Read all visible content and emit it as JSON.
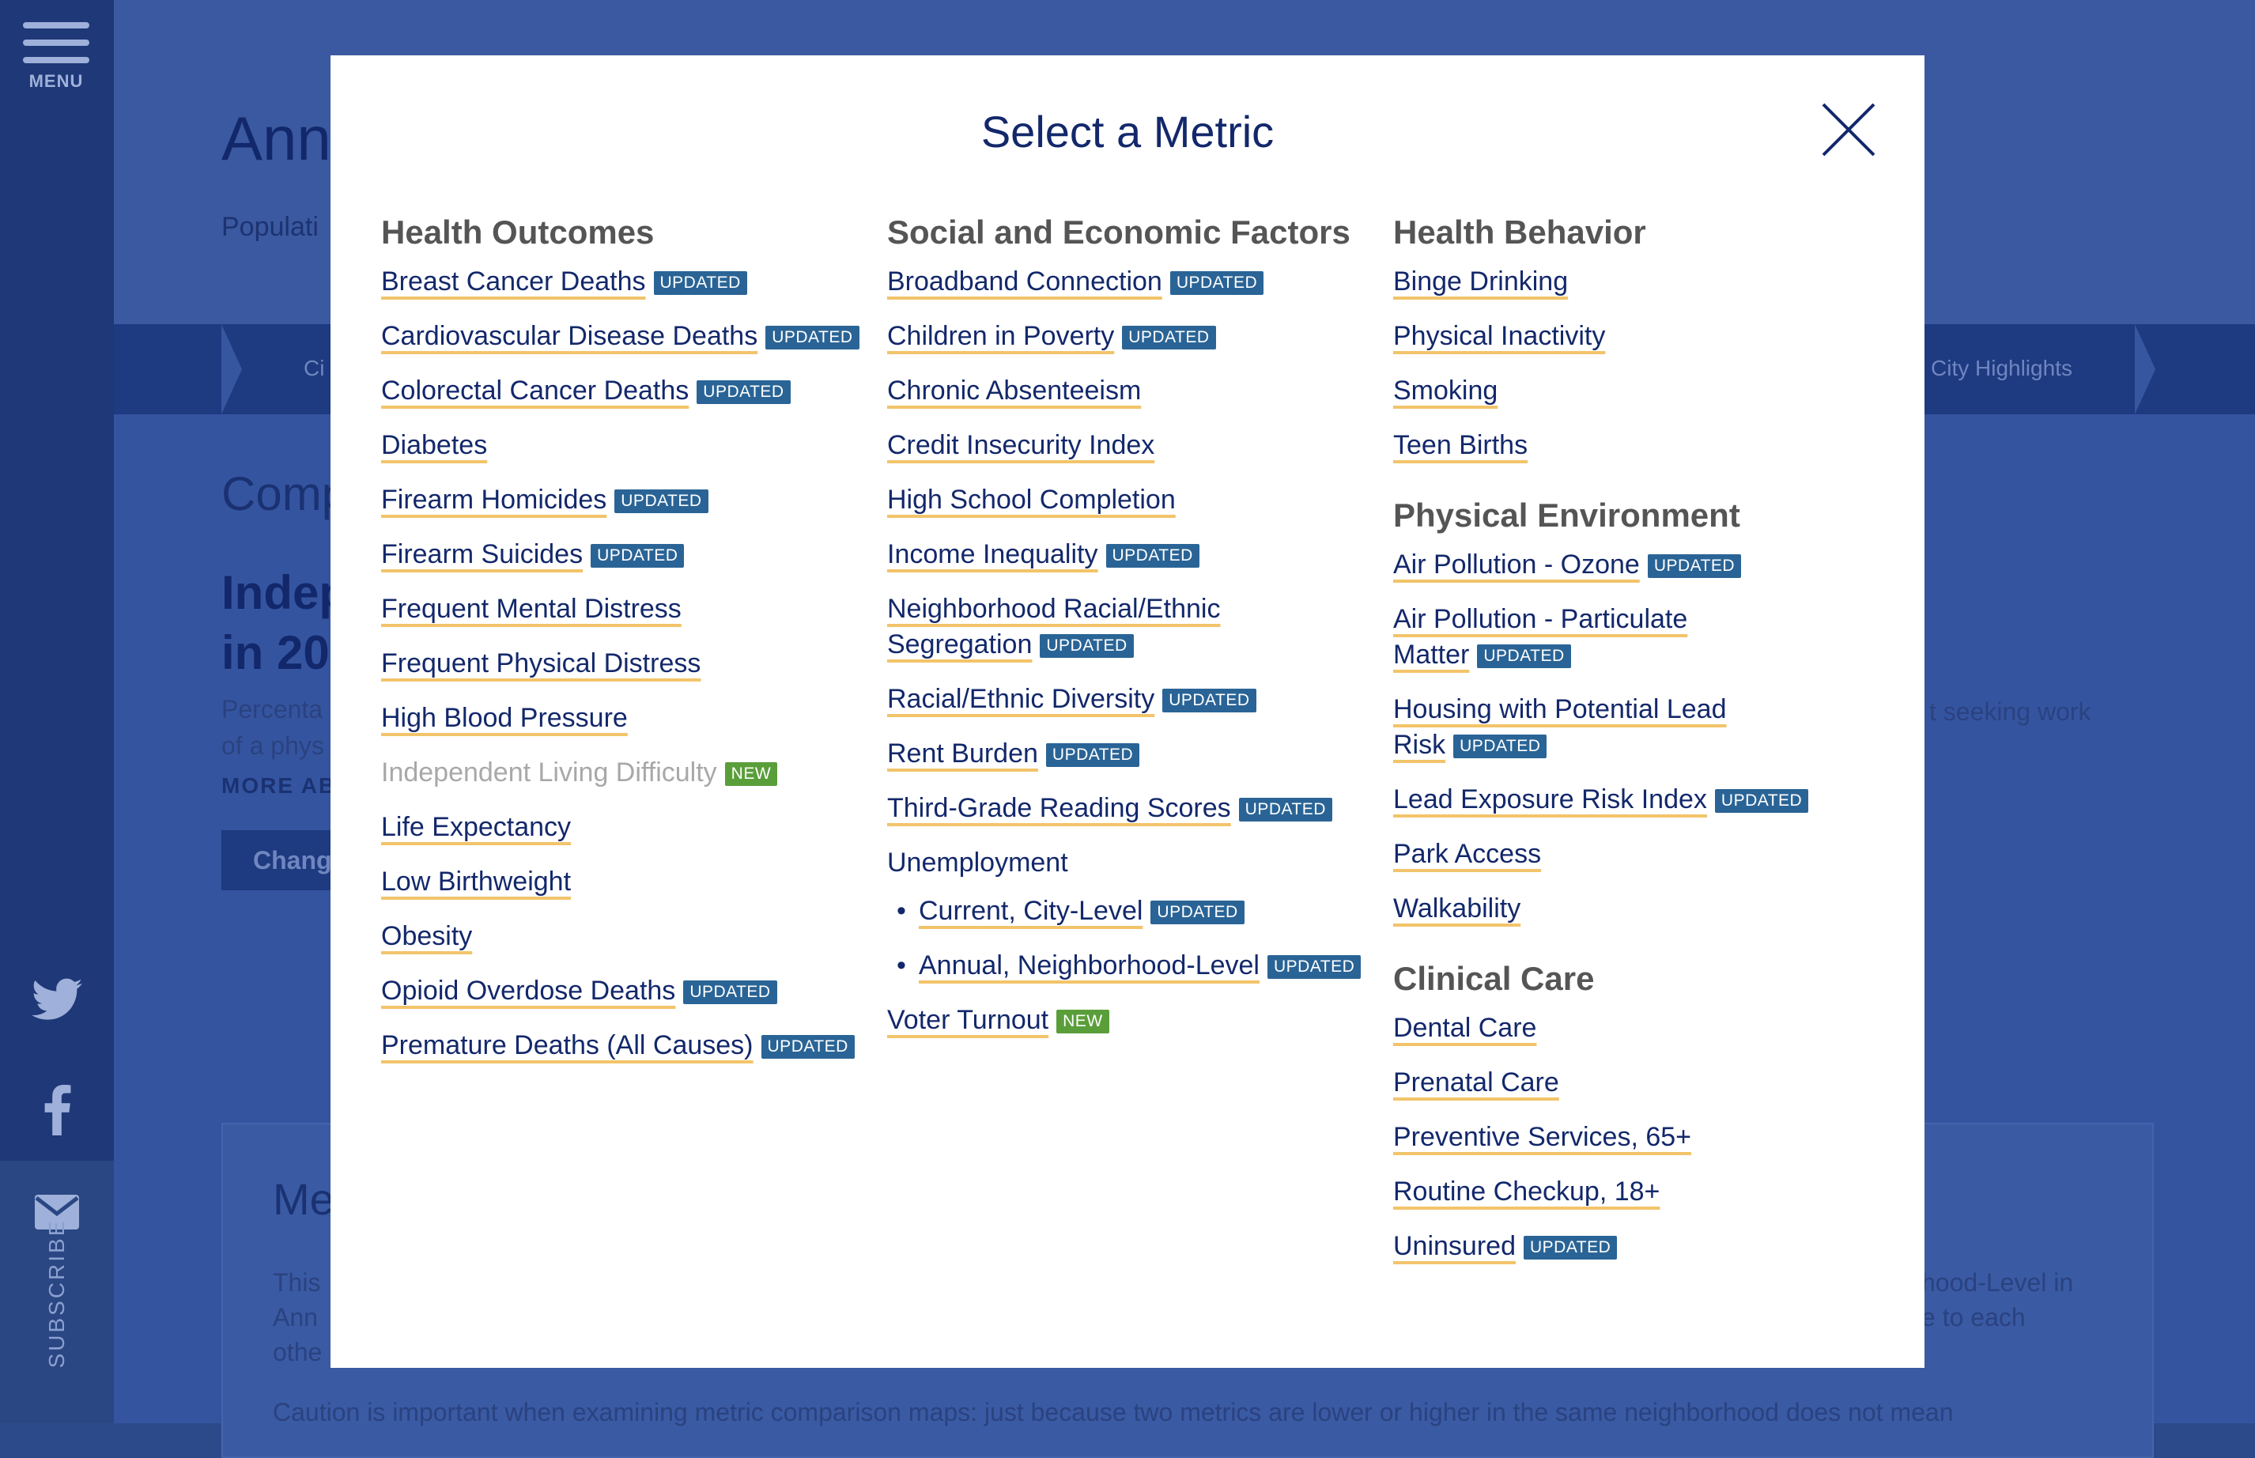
{
  "sidebar": {
    "menu_label": "MENU",
    "subscribe_label": "SUBSCRIBE",
    "twitter_icon": "twitter-icon",
    "facebook_icon": "facebook-icon",
    "mail_icon": "mail-icon"
  },
  "background": {
    "title": "Ann",
    "subtitle": "Populati",
    "nav_left": "Ci",
    "nav_right": "City Highlights",
    "section_heading": "Comp",
    "metric_heading_1": "Indep",
    "metric_heading_2": "in 20",
    "desc_1": "Percenta",
    "desc_2": "of a phys",
    "more": "MORE AB",
    "change_button": "Chang",
    "right_text": "t seeking work",
    "card_heading": "Me",
    "card_text_1": "This",
    "card_text_2": "Ann",
    "card_text_3": "othe",
    "card_right_1": "hood-Level in",
    "card_right_2": "e to each",
    "caution": "Caution is important when examining metric comparison maps: just because two metrics are lower or higher in the same neighborhood does not mean"
  },
  "modal": {
    "title": "Select a Metric",
    "close_icon": "close-icon",
    "badge_updated": "UPDATED",
    "badge_new": "NEW",
    "health_outcomes": {
      "heading": "Health Outcomes",
      "items": [
        {
          "label": "Breast Cancer Deaths",
          "badge": "UPDATED"
        },
        {
          "label": "Cardiovascular Disease Deaths",
          "badge": "UPDATED"
        },
        {
          "label": "Colorectal Cancer Deaths",
          "badge": "UPDATED"
        },
        {
          "label": "Diabetes",
          "badge": ""
        },
        {
          "label": "Firearm Homicides",
          "badge": "UPDATED"
        },
        {
          "label": "Firearm Suicides",
          "badge": "UPDATED"
        },
        {
          "label": "Frequent Mental Distress",
          "badge": ""
        },
        {
          "label": "Frequent Physical Distress",
          "badge": ""
        },
        {
          "label": "High Blood Pressure",
          "badge": ""
        },
        {
          "label": "Independent Living Difficulty",
          "badge": "NEW"
        },
        {
          "label": "Life Expectancy",
          "badge": ""
        },
        {
          "label": "Low Birthweight",
          "badge": ""
        },
        {
          "label": "Obesity",
          "badge": ""
        },
        {
          "label": "Opioid Overdose Deaths",
          "badge": "UPDATED"
        },
        {
          "label": "Premature Deaths (All Causes)",
          "badge": "UPDATED"
        }
      ]
    },
    "social_economic": {
      "heading": "Social and Economic Factors",
      "items": [
        {
          "label": "Broadband Connection",
          "badge": "UPDATED"
        },
        {
          "label": "Children in Poverty",
          "badge": "UPDATED"
        },
        {
          "label": "Chronic Absenteeism",
          "badge": ""
        },
        {
          "label": "Credit Insecurity Index",
          "badge": ""
        },
        {
          "label": "High School Completion",
          "badge": ""
        },
        {
          "label": "Income Inequality",
          "badge": "UPDATED"
        },
        {
          "label_1": "Neighborhood Racial/Ethnic",
          "label_2": "Segregation",
          "badge": "UPDATED"
        },
        {
          "label": "Racial/Ethnic Diversity",
          "badge": "UPDATED"
        },
        {
          "label": "Rent Burden",
          "badge": "UPDATED"
        },
        {
          "label": "Third-Grade Reading Scores",
          "badge": "UPDATED"
        }
      ],
      "unemployment": {
        "heading": "Unemployment",
        "items": [
          {
            "label": "Current, City-Level",
            "badge": "UPDATED"
          },
          {
            "label": "Annual, Neighborhood-Level",
            "badge": "UPDATED"
          }
        ]
      },
      "voter_turnout": {
        "label": "Voter Turnout",
        "badge": "NEW"
      }
    },
    "health_behavior": {
      "heading": "Health Behavior",
      "items": [
        {
          "label": "Binge Drinking"
        },
        {
          "label": "Physical Inactivity"
        },
        {
          "label": "Smoking"
        },
        {
          "label": "Teen Births"
        }
      ]
    },
    "physical_environment": {
      "heading": "Physical Environment",
      "items": [
        {
          "label": "Air Pollution - Ozone",
          "badge": "UPDATED"
        },
        {
          "label_1": "Air Pollution - Particulate",
          "label_2": "Matter",
          "badge": "UPDATED"
        },
        {
          "label_1": "Housing with Potential Lead",
          "label_2": "Risk",
          "badge": "UPDATED"
        },
        {
          "label": "Lead Exposure Risk Index",
          "badge": "UPDATED"
        },
        {
          "label": "Park Access"
        },
        {
          "label": "Walkability"
        }
      ]
    },
    "clinical_care": {
      "heading": "Clinical Care",
      "items": [
        {
          "label": "Dental Care"
        },
        {
          "label": "Prenatal Care"
        },
        {
          "label": "Preventive Services, 65+"
        },
        {
          "label": "Routine Checkup, 18+"
        },
        {
          "label": "Uninsured",
          "badge": "UPDATED"
        }
      ]
    }
  }
}
